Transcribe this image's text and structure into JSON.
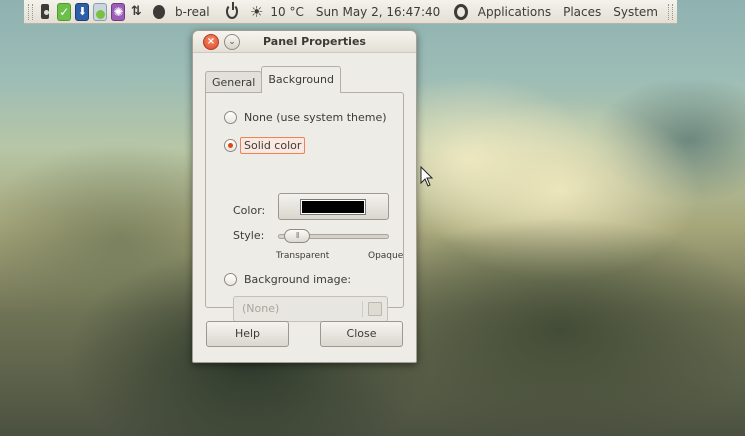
{
  "top_panel": {
    "user": "b-real",
    "weather": "10 °C",
    "clock": "Sun May  2, 16:47:40",
    "menus": [
      "Applications",
      "Places",
      "System"
    ],
    "icons": [
      "speaker-icon",
      "checkmark-icon",
      "blue-app-icon",
      "network-icon",
      "purple-app-icon",
      "transfer-arrows-icon",
      "status-blob-icon",
      "power-icon",
      "sun-icon",
      "ubuntu-logo-icon"
    ]
  },
  "dialog": {
    "title": "Panel Properties",
    "tabs": [
      {
        "label": "General",
        "active": false
      },
      {
        "label": "Background",
        "active": true
      }
    ],
    "background": {
      "none_label": "None (use system theme)",
      "solid_label": "Solid color",
      "selected": "solid",
      "color_label": "Color:",
      "color_value": "#000000",
      "style_label": "Style:",
      "slider_min_label": "Transparent",
      "slider_max_label": "Opaque",
      "opacity": 0.05,
      "image_label": "Background image:",
      "image_value": "(None)"
    },
    "buttons": {
      "help": "Help",
      "close": "Close"
    }
  },
  "colors": {
    "accent": "#dd4814",
    "panel": "#e3dfd4",
    "dialog": "#edece7"
  }
}
